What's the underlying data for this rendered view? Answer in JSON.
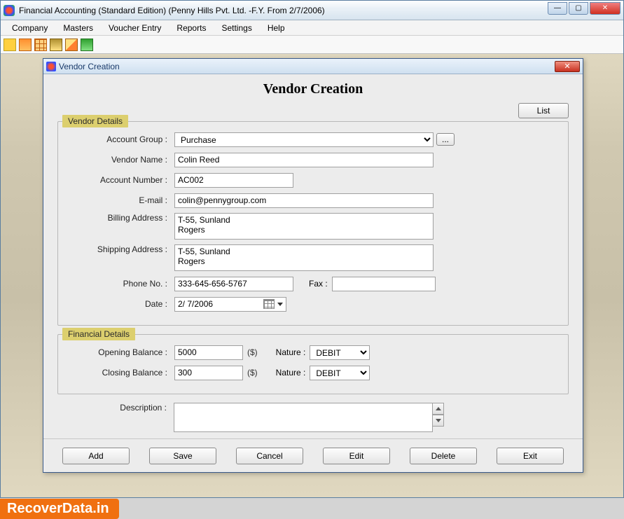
{
  "window": {
    "title": "Financial Accounting (Standard Edition) (Penny Hills Pvt. Ltd. -F.Y. From 2/7/2006)"
  },
  "menu": {
    "items": [
      "Company",
      "Masters",
      "Voucher Entry",
      "Reports",
      "Settings",
      "Help"
    ]
  },
  "toolbar": {
    "icons": [
      "new-doc",
      "edit-doc",
      "grid",
      "balance",
      "pencil",
      "chart"
    ]
  },
  "dialog": {
    "title": "Vendor Creation",
    "heading": "Vendor Creation",
    "list_button": "List",
    "sections": {
      "vendor_legend": "Vendor Details",
      "financial_legend": "Financial Details"
    },
    "labels": {
      "account_group": "Account Group :",
      "vendor_name": "Vendor Name :",
      "account_number": "Account Number :",
      "email": "E-mail :",
      "billing_address": "Billing Address :",
      "shipping_address": "Shipping Address :",
      "phone": "Phone No. :",
      "fax": "Fax :",
      "date": "Date :",
      "opening_balance": "Opening Balance :",
      "closing_balance": "Closing Balance :",
      "nature": "Nature :",
      "description": "Description :",
      "currency": "($)"
    },
    "values": {
      "account_group": "Purchase",
      "vendor_name": "Colin Reed",
      "account_number": "AC002",
      "email": "colin@pennygroup.com",
      "billing_address": "T-55, Sunland\nRogers",
      "shipping_address": "T-55, Sunland\nRogers",
      "phone": "333-645-656-5767",
      "fax": "",
      "date": " 2/  7/2006",
      "opening_balance": "5000",
      "opening_nature": "DEBIT",
      "closing_balance": "300",
      "closing_nature": "DEBIT",
      "description": ""
    },
    "ellipsis": "...",
    "footer_buttons": [
      "Add",
      "Save",
      "Cancel",
      "Edit",
      "Delete",
      "Exit"
    ]
  },
  "watermark": "RecoverData.in"
}
